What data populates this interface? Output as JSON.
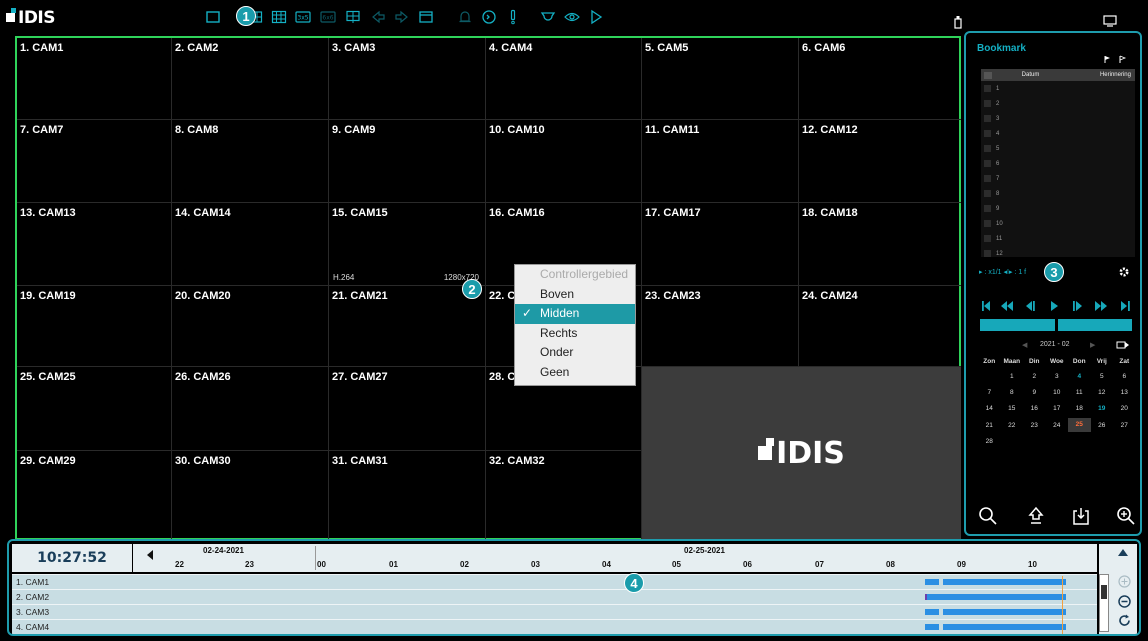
{
  "app": {
    "logo_text": "IDIS"
  },
  "toolbar": {
    "icons": [
      "single-view-icon",
      "grid-4-icon",
      "grid-9-icon",
      "grid-3x3-icon",
      "grid-16-icon",
      "custom-layout-icon",
      "previous-group-icon",
      "next-group-icon",
      "window-icon",
      "alarm-icon",
      "call-icon",
      "alert-icon",
      "dome-camera-icon",
      "watch-icon",
      "play-icon"
    ],
    "right_icons": [
      "usb-icon",
      "panel-toggle-icon"
    ]
  },
  "callouts": [
    "1",
    "2",
    "3",
    "4"
  ],
  "cameras": [
    "1. CAM1",
    "2. CAM2",
    "3. CAM3",
    "4. CAM4",
    "5. CAM5",
    "6. CAM6",
    "7. CAM7",
    "8. CAM8",
    "9. CAM9",
    "10. CAM10",
    "11. CAM11",
    "12. CAM12",
    "13. CAM13",
    "14. CAM14",
    "15. CAM15",
    "16. CAM16",
    "17. CAM17",
    "18. CAM18",
    "19. CAM19",
    "20. CAM20",
    "21. CAM21",
    "22. CAM22",
    "23. CAM23",
    "24. CAM24",
    "25. CAM25",
    "26. CAM26",
    "27. CAM27",
    "28. CAM28",
    "29. CAM29",
    "30. CAM30",
    "31. CAM31",
    "32. CAM32"
  ],
  "camera_overlay": {
    "codec": "H.264",
    "resolution": "1280x720"
  },
  "placeholder_logo": "IDIS",
  "context_menu": {
    "header": "Controllergebied",
    "items": [
      {
        "label": "Boven",
        "selected": false
      },
      {
        "label": "Midden",
        "selected": true
      },
      {
        "label": "Rechts",
        "selected": false
      },
      {
        "label": "Onder",
        "selected": false
      },
      {
        "label": "Geen",
        "selected": false
      }
    ],
    "check": "✓"
  },
  "bookmark": {
    "title": "Bookmark",
    "col_date": "Datum",
    "col_reminder": "Herinnering",
    "rows": [
      "1",
      "2",
      "3",
      "4",
      "5",
      "6",
      "7",
      "8",
      "9",
      "10",
      "11",
      "12"
    ]
  },
  "playback": {
    "speed_text": "▸ : x1/1 ◂I▸ : 1 f",
    "progress_segments": 2
  },
  "calendar": {
    "month": "2021 - 02",
    "days_of_week": [
      "Zon",
      "Maan",
      "Din",
      "Woe",
      "Don",
      "Vrij",
      "Zat"
    ],
    "weeks": [
      [
        "",
        "1",
        "2",
        "3",
        "4",
        "5",
        "6"
      ],
      [
        "7",
        "8",
        "9",
        "10",
        "11",
        "12",
        "13"
      ],
      [
        "14",
        "15",
        "16",
        "17",
        "18",
        "19",
        "20"
      ],
      [
        "21",
        "22",
        "23",
        "24",
        "25",
        "26",
        "27"
      ],
      [
        "28",
        "",
        "",
        "",
        "",
        "",
        ""
      ]
    ],
    "record_days": [
      "4",
      "19"
    ],
    "today": "25"
  },
  "timeline": {
    "current_time": "10:27:52",
    "date_left": "02-24-2021",
    "date_right": "02-25-2021",
    "ticks": [
      "22",
      "23",
      "00",
      "01",
      "02",
      "03",
      "04",
      "05",
      "06",
      "07",
      "08",
      "09",
      "10"
    ],
    "rows": [
      "1. CAM1",
      "2. CAM2",
      "3. CAM3",
      "4. CAM4"
    ]
  },
  "colors": {
    "accent": "#1e9cad",
    "grid_border": "#2fd35a",
    "record_bar": "#2b8fe3",
    "today": "#ff6d3a"
  }
}
